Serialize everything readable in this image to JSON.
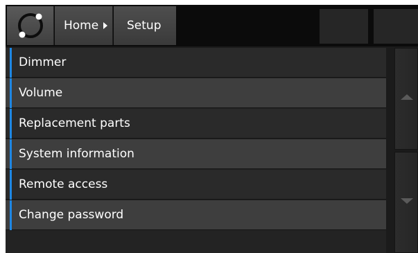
{
  "header": {
    "breadcrumb_home": "Home",
    "breadcrumb_current": "Setup"
  },
  "menu": {
    "items": [
      {
        "label": "Dimmer"
      },
      {
        "label": "Volume"
      },
      {
        "label": "Replacement parts"
      },
      {
        "label": "System information"
      },
      {
        "label": "Remote access"
      },
      {
        "label": "Change password"
      }
    ]
  },
  "icons": {
    "logo": "ring-logo-icon",
    "breadcrumb_separator": "caret-right-icon",
    "scroll_up": "triangle-up-icon",
    "scroll_down": "triangle-down-icon"
  },
  "colors": {
    "accent": "#1e88e5",
    "background": "#1b1b1b",
    "row_light": "#3e3e3e",
    "row_dark": "#2a2a2a"
  }
}
